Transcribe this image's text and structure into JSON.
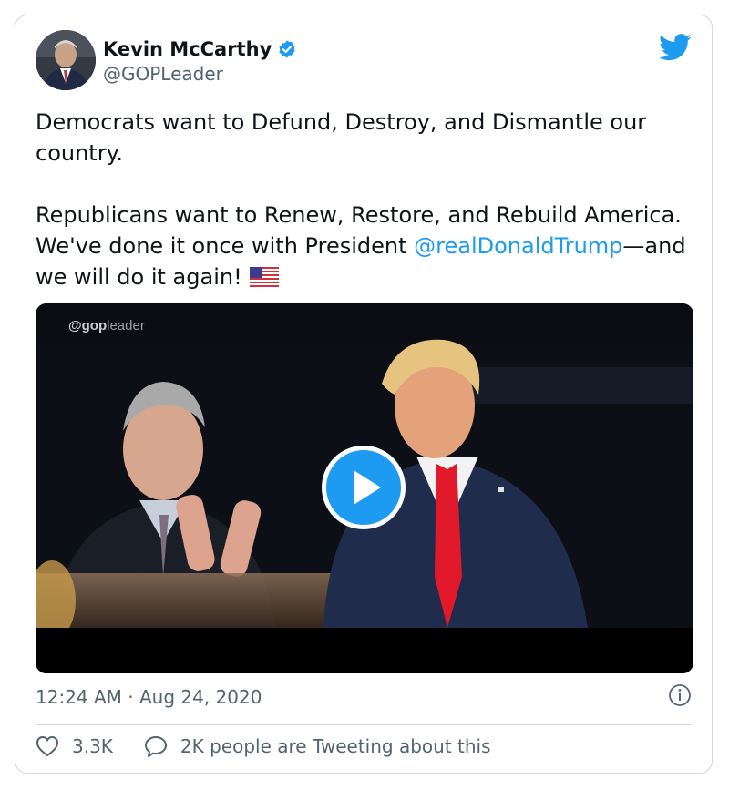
{
  "author": {
    "name": "Kevin McCarthy",
    "handle": "@GOPLeader"
  },
  "tweet": {
    "para1": "Democrats want to Defund, Destroy, and Dismantle our country.",
    "para2_line1": "Republicans want to Renew, Restore, and Rebuild America. We've done it once with President ",
    "mention": "@realDonaldTrump",
    "para2_tail": "—and we will do it again!",
    "flag_emoji": "flag-us-icon"
  },
  "media": {
    "watermark_bold": "@gop",
    "watermark_rest": "leader"
  },
  "meta": {
    "timestamp": "12:24 AM · Aug 24, 2020"
  },
  "actions": {
    "likes": "3.3K",
    "talking": "2K people are Tweeting about this"
  },
  "colors": {
    "accent": "#1d9bf0",
    "text": "#0f1419",
    "secondary": "#536471",
    "border": "#cfd9de"
  }
}
